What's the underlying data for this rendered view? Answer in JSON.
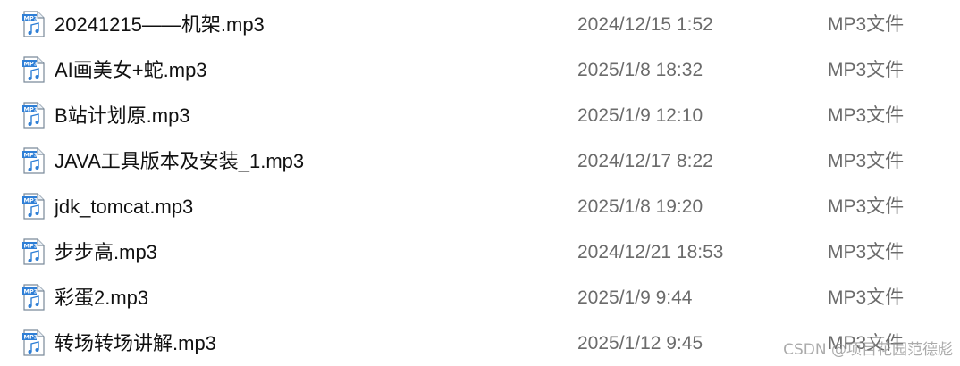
{
  "files": [
    {
      "name": "20241215——机架.mp3",
      "date": "2024/12/15 1:52",
      "type": "MP3文件",
      "icon": "mp3-file-icon"
    },
    {
      "name": "AI画美女+蛇.mp3",
      "date": "2025/1/8 18:32",
      "type": "MP3文件",
      "icon": "mp3-file-icon"
    },
    {
      "name": "B站计划原.mp3",
      "date": "2025/1/9 12:10",
      "type": "MP3文件",
      "icon": "mp3-file-icon"
    },
    {
      "name": "JAVA工具版本及安装_1.mp3",
      "date": "2024/12/17 8:22",
      "type": "MP3文件",
      "icon": "mp3-file-icon"
    },
    {
      "name": "jdk_tomcat.mp3",
      "date": "2025/1/8 19:20",
      "type": "MP3文件",
      "icon": "mp3-file-icon"
    },
    {
      "name": "步步高.mp3",
      "date": "2024/12/21 18:53",
      "type": "MP3文件",
      "icon": "mp3-file-icon"
    },
    {
      "name": "彩蛋2.mp3",
      "date": "2025/1/9 9:44",
      "type": "MP3文件",
      "icon": "mp3-file-icon"
    },
    {
      "name": "转场转场讲解.mp3",
      "date": "2025/1/12 9:45",
      "type": "MP3文件",
      "icon": "mp3-file-icon"
    }
  ],
  "watermark": "CSDN @项目花园范德彪",
  "colors": {
    "name_text": "#111111",
    "meta_text": "#6b6b6b",
    "icon_accent": "#2f7fd6"
  }
}
